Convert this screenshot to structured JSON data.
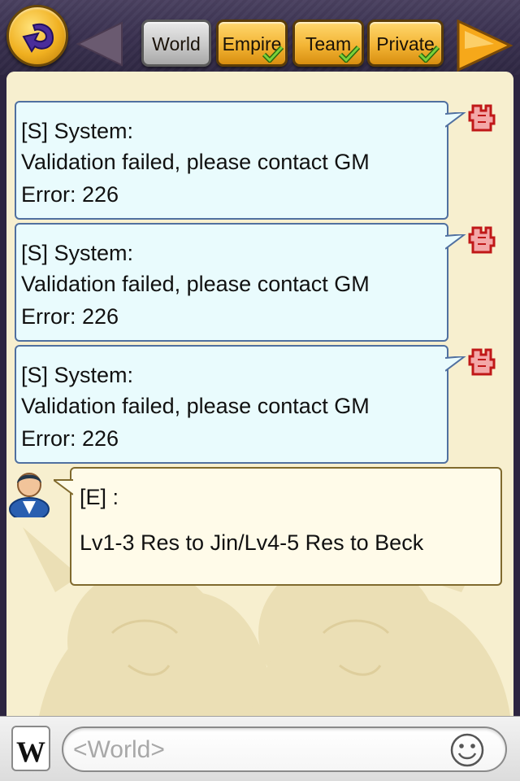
{
  "header": {
    "back_icon": "back-arrow-icon",
    "tabs": [
      {
        "label": "World",
        "active": true,
        "checked": false
      },
      {
        "label": "Empire",
        "active": false,
        "checked": true
      },
      {
        "label": "Team",
        "active": false,
        "checked": true
      },
      {
        "label": "Private",
        "active": false,
        "checked": true
      }
    ]
  },
  "messages": [
    {
      "sender": "[S] System:",
      "text": "Validation failed, please contact GM",
      "error": "Error: 226",
      "icon": "gm-puzzle-icon"
    },
    {
      "sender": "[S] System:",
      "text": "Validation failed, please contact GM",
      "error": "Error: 226",
      "icon": "gm-puzzle-icon"
    },
    {
      "sender": "[S] System:",
      "text": "Validation failed, please contact GM",
      "error": "Error: 226",
      "icon": "gm-puzzle-icon"
    }
  ],
  "user_message": {
    "sender": "[E] :",
    "text": "Lv1-3 Res to Jin/Lv4-5 Res to Beck",
    "avatar": "user-avatar-icon"
  },
  "input_bar": {
    "channel_button": "W",
    "placeholder": "<World>",
    "emoji_icon": "smiley-icon"
  },
  "colors": {
    "system_bubble": "#e9fbfd",
    "user_bubble": "#fffbe9",
    "chat_background": "#f7efcf",
    "tab_gold": "#f3b535",
    "tab_active": "#c9c9c9"
  }
}
